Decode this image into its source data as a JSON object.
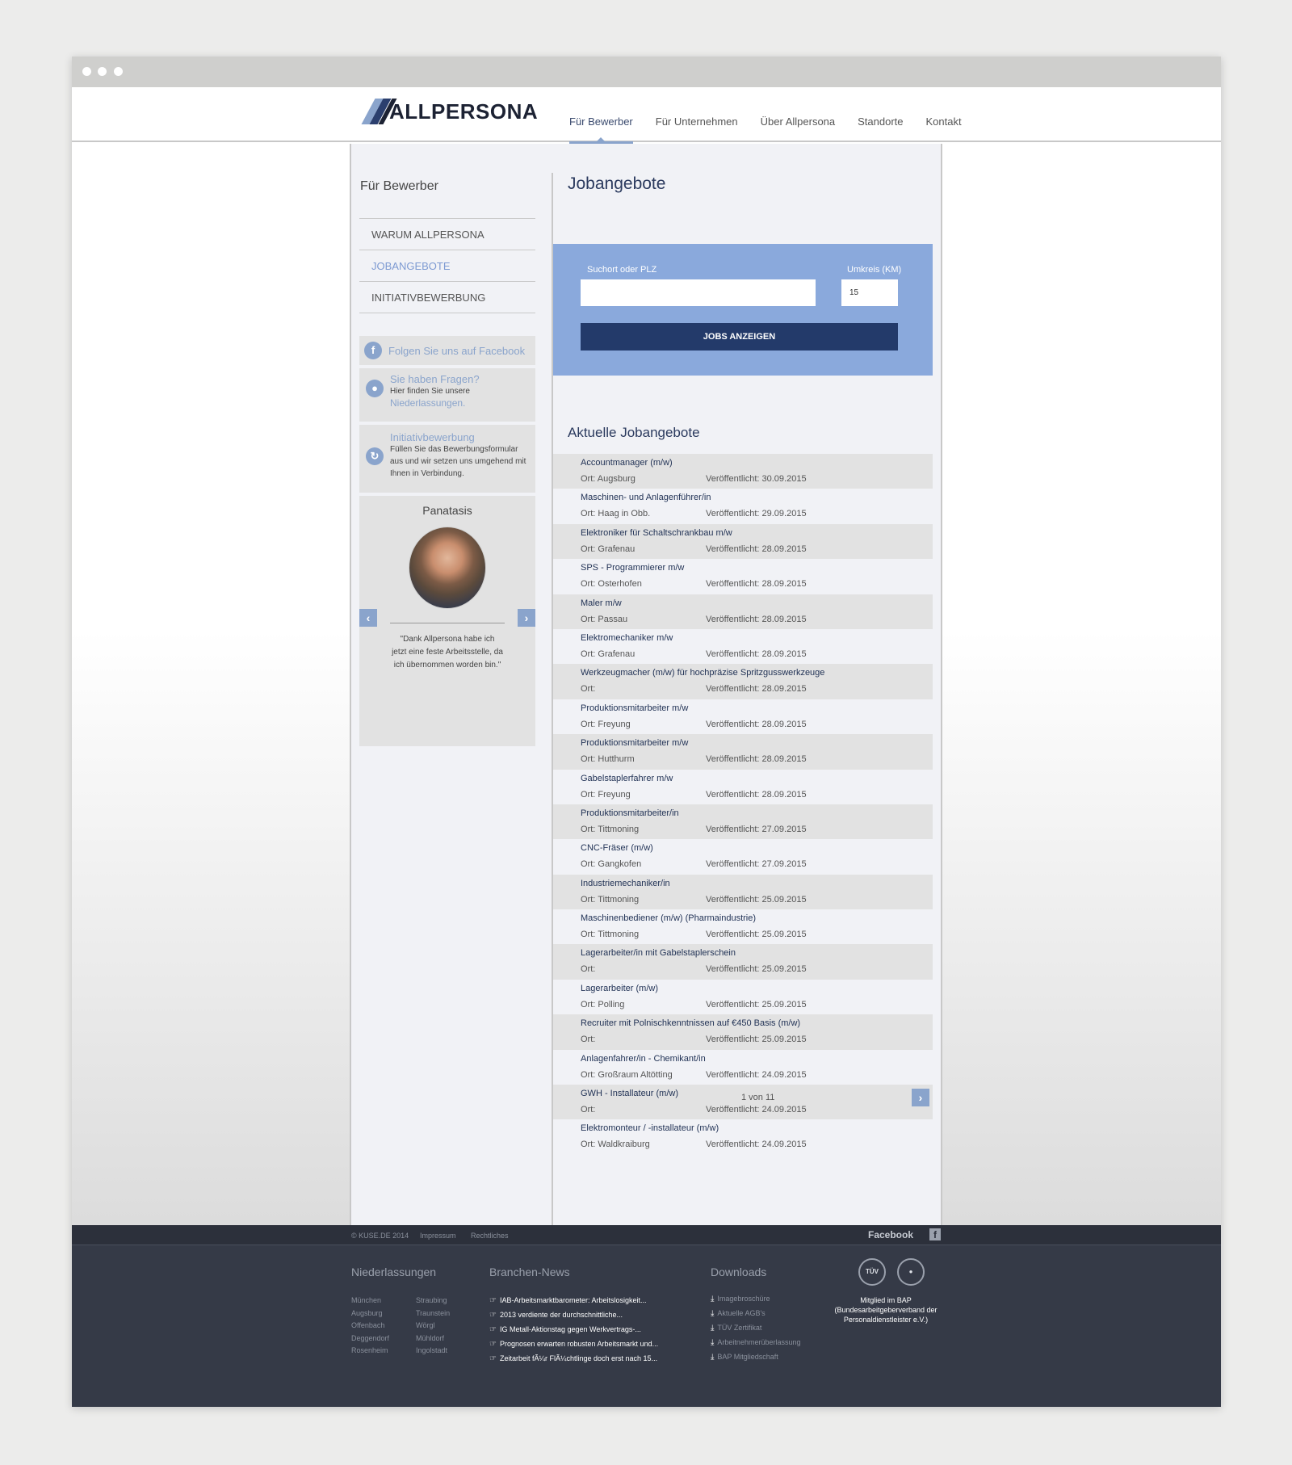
{
  "header": {
    "logo": "ALLPERSONA",
    "nav": [
      "Für Bewerber",
      "Für Unternehmen",
      "Über Allpersona",
      "Standorte",
      "Kontakt"
    ]
  },
  "sidebar": {
    "title": "Für Bewerber",
    "menu": [
      "WARUM ALLPERSONA",
      "JOBANGEBOTE",
      "INITIATIVBEWERBUNG"
    ],
    "facebook": "Folgen Sie uns auf Facebook",
    "questions": {
      "title": "Sie haben Fragen?",
      "text": "Hier finden Sie unsere",
      "link": "Niederlassungen."
    },
    "initiative": {
      "title": "Initiativbewerbung",
      "text": "Füllen Sie das Bewerbungsformular aus und wir setzen uns umgehend mit Ihnen in Verbindung."
    },
    "testimonial": {
      "name": "Panatasis",
      "quote": "\"Dank Allpersona habe ich jetzt eine feste Arbeitsstelle, da ich übernommen worden bin.\""
    }
  },
  "main": {
    "title": "Jobangebote",
    "search": {
      "label_location": "Suchort oder PLZ",
      "label_radius": "Umkreis (KM)",
      "location_value": "",
      "radius_value": "15",
      "button": "JOBS ANZEIGEN"
    },
    "subtitle": "Aktuelle Jobangebote",
    "ort_prefix": "Ort:",
    "date_prefix": "Veröffentlicht:",
    "jobs": [
      {
        "title": "Accountmanager (m/w)",
        "ort": "Ort: Augsburg",
        "date": "Veröffentlicht: 30.09.2015"
      },
      {
        "title": "Maschinen- und Anlagenführer/in",
        "ort": "Ort: Haag in Obb.",
        "date": "Veröffentlicht: 29.09.2015"
      },
      {
        "title": "Elektroniker für Schaltschrankbau m/w",
        "ort": "Ort: Grafenau",
        "date": "Veröffentlicht: 28.09.2015"
      },
      {
        "title": "SPS - Programmierer m/w",
        "ort": "Ort: Osterhofen",
        "date": "Veröffentlicht: 28.09.2015"
      },
      {
        "title": "Maler m/w",
        "ort": "Ort: Passau",
        "date": "Veröffentlicht: 28.09.2015"
      },
      {
        "title": "Elektromechaniker m/w",
        "ort": "Ort: Grafenau",
        "date": "Veröffentlicht: 28.09.2015"
      },
      {
        "title": "Werkzeugmacher (m/w) für hochpräzise Spritzgusswerkzeuge",
        "ort": "Ort:",
        "date": "Veröffentlicht: 28.09.2015"
      },
      {
        "title": "Produktionsmitarbeiter m/w",
        "ort": "Ort: Freyung",
        "date": "Veröffentlicht: 28.09.2015"
      },
      {
        "title": "Produktionsmitarbeiter m/w",
        "ort": "Ort: Hutthurm",
        "date": "Veröffentlicht: 28.09.2015"
      },
      {
        "title": "Gabelstaplerfahrer m/w",
        "ort": "Ort: Freyung",
        "date": "Veröffentlicht: 28.09.2015"
      },
      {
        "title": "Produktionsmitarbeiter/in",
        "ort": "Ort: Tittmoning",
        "date": "Veröffentlicht: 27.09.2015"
      },
      {
        "title": "CNC-Fräser (m/w)",
        "ort": "Ort: Gangkofen",
        "date": "Veröffentlicht: 27.09.2015"
      },
      {
        "title": "Industriemechaniker/in",
        "ort": "Ort: Tittmoning",
        "date": "Veröffentlicht: 25.09.2015"
      },
      {
        "title": "Maschinenbediener (m/w) (Pharmaindustrie)",
        "ort": "Ort: Tittmoning",
        "date": "Veröffentlicht: 25.09.2015"
      },
      {
        "title": "Lagerarbeiter/in mit Gabelstaplerschein",
        "ort": "Ort:",
        "date": "Veröffentlicht: 25.09.2015"
      },
      {
        "title": "Lagerarbeiter (m/w)",
        "ort": "Ort: Polling",
        "date": "Veröffentlicht: 25.09.2015"
      },
      {
        "title": "Recruiter mit Polnischkenntnissen auf €450 Basis (m/w)",
        "ort": "Ort:",
        "date": "Veröffentlicht: 25.09.2015"
      },
      {
        "title": "Anlagenfahrer/in - Chemikant/in",
        "ort": "Ort: Großraum Altötting",
        "date": "Veröffentlicht: 24.09.2015"
      },
      {
        "title": "GWH - Installateur (m/w)",
        "ort": "Ort:",
        "date": "Veröffentlicht: 24.09.2015"
      },
      {
        "title": "Elektromonteur / -installateur (m/w)",
        "ort": "Ort: Waldkraiburg",
        "date": "Veröffentlicht: 24.09.2015"
      }
    ],
    "pager": "1 von 11"
  },
  "footer": {
    "copyright": "© KUSE.DE 2014",
    "impressum": "Impressum",
    "rechtliches": "Rechtliches",
    "facebook": "Facebook",
    "niederlassungen_title": "Niederlassungen",
    "niederlassungen_col1": [
      "München",
      "Augsburg",
      "Offenbach",
      "Deggendorf",
      "Rosenheim"
    ],
    "niederlassungen_col2": [
      "Straubing",
      "Traunstein",
      "Wörgl",
      "Mühldorf",
      "Ingolstadt"
    ],
    "news_title": "Branchen-News",
    "news": [
      "IAB-Arbeitsmarktbarometer: Arbeitslosigkeit...",
      "2013 verdiente der durchschnittliche...",
      "IG Metall-Aktionstag gegen Werkvertrags-...",
      "Prognosen erwarten robusten Arbeitsmarkt und...",
      "Zeitarbeit fÃ¼r FlÃ¼chtlinge doch erst nach 15..."
    ],
    "downloads_title": "Downloads",
    "downloads": [
      "Imagebroschüre",
      "Aktuelle AGB's",
      "TÜV Zertifikat",
      "Arbeitnehmerüberlassung",
      "BAP Mitgliedschaft"
    ],
    "seal1": "TÜV",
    "bap": "Mitglied im BAP (Bundesarbeitgeberverband der Personaldienstleister e.V.)"
  }
}
